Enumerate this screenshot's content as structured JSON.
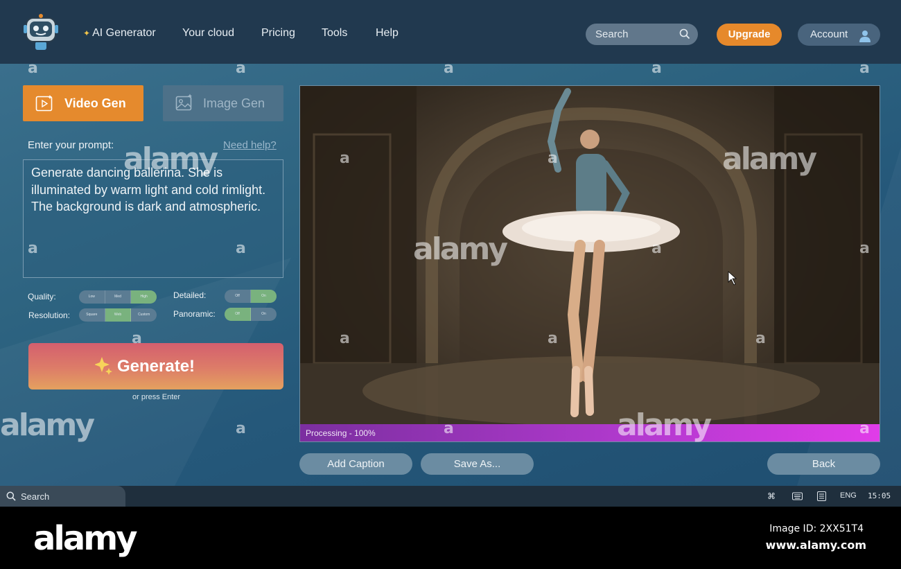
{
  "nav": {
    "items": [
      {
        "label": "AI Generator",
        "icon": "sparkle-icon"
      },
      {
        "label": "Your cloud"
      },
      {
        "label": "Pricing"
      },
      {
        "label": "Tools"
      },
      {
        "label": "Help"
      }
    ],
    "search_placeholder": "Search",
    "upgrade_label": "Upgrade",
    "account_label": "Account"
  },
  "tabs": {
    "video_label": "Video Gen",
    "image_label": "Image Gen",
    "active": "Video Gen"
  },
  "prompt": {
    "label": "Enter your prompt:",
    "help_link": "Need help?",
    "value": "Generate dancing ballerina.  She is illuminated by warm light and cold rimlight. The background is dark and atmospheric."
  },
  "options": {
    "quality": {
      "label": "Quality:",
      "choices": [
        "Low",
        "Med",
        "High"
      ],
      "selected": "High"
    },
    "resolution": {
      "label": "Resolution:",
      "choices": [
        "Square",
        "Web",
        "Custom"
      ],
      "selected": "Web"
    },
    "detailed": {
      "label": "Detailed:",
      "choices": [
        "Off",
        "On"
      ],
      "selected": "On"
    },
    "panoramic": {
      "label": "Panoramic:",
      "choices": [
        "Off",
        "On"
      ],
      "selected": "Off"
    }
  },
  "generate": {
    "label": "Generate!",
    "hint": "or press Enter"
  },
  "preview": {
    "progress_text": "Processing - 100%",
    "progress_fraction": 1.0
  },
  "actions": {
    "add_caption": "Add Caption",
    "save_as": "Save As...",
    "back": "Back"
  },
  "taskbar": {
    "search_label": "Search",
    "language": "ENG",
    "time": "15:05"
  },
  "watermark": {
    "brand": "alamy",
    "letter": "a"
  },
  "footer": {
    "brand": "alamy",
    "image_id": "Image ID: 2XX51T4",
    "url": "www.alamy.com"
  },
  "colors": {
    "nav_bg": "#21394f",
    "accent_orange": "#e58a2d",
    "toggle_on": "#79b27e",
    "progress": "#e03ce8"
  }
}
